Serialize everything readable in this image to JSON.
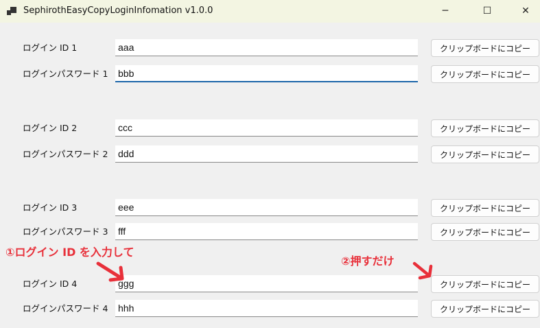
{
  "window": {
    "title": "SephirothEasyCopyLoginInfomation v1.0.0",
    "minimize": "─",
    "maximize": "☐",
    "close": "✕"
  },
  "rows": [
    {
      "label": "ログイン ID 1",
      "value": "aaa"
    },
    {
      "label": "ログインパスワード 1",
      "value": "bbb"
    },
    {
      "label": "ログイン ID 2",
      "value": "ccc"
    },
    {
      "label": "ログインパスワード 2",
      "value": "ddd"
    },
    {
      "label": "ログイン ID 3",
      "value": "eee"
    },
    {
      "label": "ログインパスワード 3",
      "value": "fff"
    },
    {
      "label": "ログイン ID 4",
      "value": "ggg"
    },
    {
      "label": "ログインパスワード 4",
      "value": "hhh"
    }
  ],
  "copy_button_label": "クリップボードにコピー",
  "annotations": {
    "step1": "①ログイン ID を入力して",
    "step2": "②押すだけ",
    "color": "#e8303a"
  }
}
